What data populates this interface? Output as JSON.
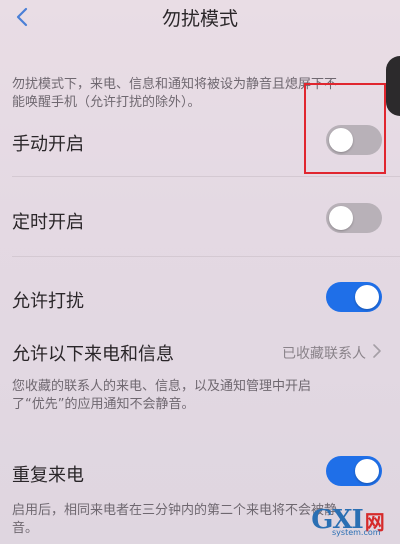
{
  "header": {
    "title": "勿扰模式",
    "back_icon": "chevron-left-icon"
  },
  "description": {
    "line1": "勿扰模式下，来电、信息和通知将被设为静音且熄屏下不",
    "line2": "能唤醒手机（允许打扰的除外）。"
  },
  "rows": [
    {
      "label": "手动开启",
      "state": "off"
    },
    {
      "label": "定时开启",
      "state": "off"
    },
    {
      "label": "允许打扰",
      "state": "on"
    }
  ],
  "allow_from": {
    "label": "允许以下来电和信息",
    "value": "已收藏联系人",
    "chevron_icon": "chevron-right-icon"
  },
  "allow_note": {
    "line1": "您收藏的联系人的来电、信息，以及通知管理中开启",
    "line2": "了“优先”的应用通知不会静音。"
  },
  "repeat_call": {
    "label": "重复来电",
    "state": "on",
    "note_line1": "启用后，相同来电者在三分钟内的第二个来电将不会被静",
    "note_line2": "音。"
  },
  "watermark": {
    "brand": "GXI",
    "brand_cn": "网",
    "site": "system.com"
  },
  "colors": {
    "accent": "#1f6fe8",
    "toggle_off": "#b8b1b8",
    "highlight": "#e0262f"
  }
}
